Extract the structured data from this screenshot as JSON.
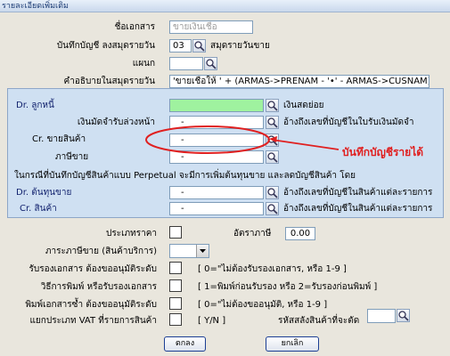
{
  "window": {
    "title": "รายละเอียดเพิ่มเติม"
  },
  "fields": {
    "doc_name_label": "ชื่อเอกสาร",
    "doc_name_value": "ขายเงินเชื่อ",
    "journal_label": "บันทึกบัญชี ลงสมุดรายวัน",
    "journal_code": "03",
    "journal_desc": "สมุดรายวันขาย",
    "dept_label": "แผนก",
    "dept_value": "",
    "desc_label": "คำอธิบายในสมุดรายวัน",
    "desc_value": "'ขายเชื่อให้   ' + (ARMAS->PRENAM - '•' - ARMAS->CUSNAM)"
  },
  "panel": {
    "rows": [
      {
        "label": "Dr. ลูกหนี้",
        "value": "",
        "note": "เงินสดย่อย"
      },
      {
        "label": "เงินมัดจำรับล่วงหน้า",
        "value": "-",
        "note": "อ้างถึงเลขที่บัญชีในใบรับเงินมัดจำ"
      },
      {
        "label": "Cr. ขายสินค้า",
        "value": "-",
        "note": ""
      },
      {
        "label": "ภาษีขาย",
        "value": "-",
        "note": ""
      }
    ],
    "perpetual_note": "ในกรณีที่บันทึกบัญชีสินค้าแบบ Perpetual  จะมีการเพิ่มต้นทุนขาย และลดบัญชีสินค้า  โดย",
    "cost_rows": [
      {
        "label": "Dr. ต้นทุนขาย",
        "value": "-",
        "note": "อ้างถึงเลขที่บัญชีในสินค้าแต่ละรายการ"
      },
      {
        "label": "Cr.  สินค้า",
        "value": "-",
        "note": "อ้างถึงเลขที่บัญชีในสินค้าแต่ละรายการ"
      }
    ],
    "callout": "บันทึกบัญชีรายได้"
  },
  "lower": {
    "price_type_label": "ประเภทราคา",
    "tax_rate_label": "อัตราภาษี",
    "tax_rate_value": "0.00",
    "tax_type_label": "ภาระภาษีขาย (สินค้าบริการ)",
    "tax_type_value": "",
    "confirm_label": "รับรองเอกสาร ต้องขออนุมัติระดับ",
    "confirm_hint": "[ 0=\"ไม่ต้องรับรองเอกสาร, หรือ 1-9 ]",
    "print_label": "วิธีการพิมพ์ หรือรับรองเอกสาร",
    "print_hint": "[ 1=พิมพ์ก่อนรับรอง  หรือ 2=รับรองก่อนพิมพ์ ]",
    "reprint_label": "พิมพ์เอกสารซ้ำ ต้องขออนุมัติระดับ",
    "reprint_hint": "[ 0=\"ไม่ต้องขออนุมัติ, หรือ 1-9 ]",
    "vat_label": "แยกประเภท VAT ที่รายการสินค้า",
    "vat_hint": "[ Y/N ]",
    "discount_label": "รหัสสลังสินค้าที่จะตัด"
  },
  "buttons": {
    "ok": "ตกลง",
    "cancel": "ยกเลิก"
  },
  "colors": {
    "panel_bg": "#cfe0f2",
    "green_field": "#9ff29f",
    "callout": "#e02020"
  }
}
